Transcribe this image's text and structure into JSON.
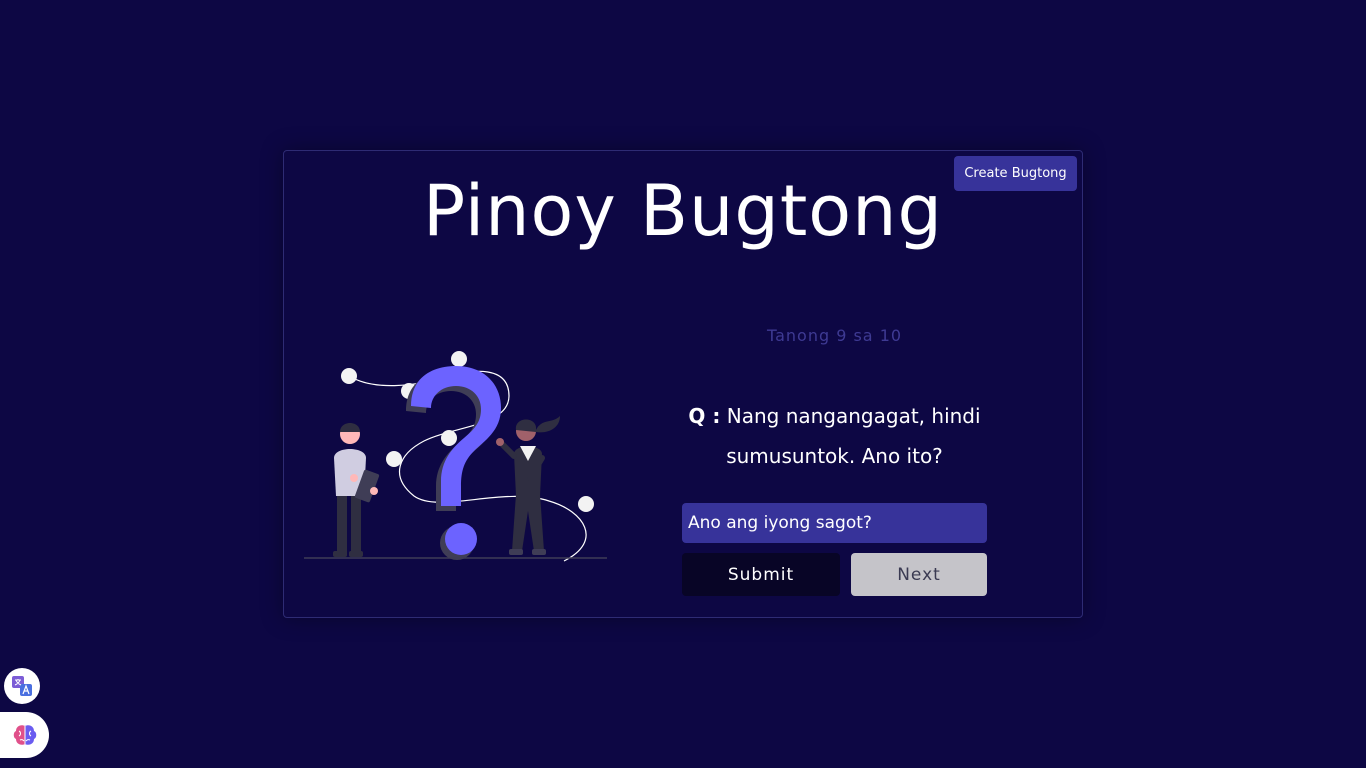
{
  "header": {
    "title": "Pinoy Bugtong",
    "create_label": "Create Bugtong"
  },
  "quiz": {
    "counter": "Tanong 9 sa 10",
    "question_label": "Q :",
    "question_text": "Nang nangangagat, hindi sumusuntok. Ano ito?",
    "answer_placeholder": "Ano ang iyong sagot?",
    "answer_value": "",
    "submit_label": "Submit",
    "next_label": "Next"
  },
  "floating": {
    "translate_icon": "translate-icon",
    "brain_icon": "brain-icon"
  },
  "colors": {
    "background": "#0d0744",
    "accent": "#37339a",
    "question_mark": "#6c63ff",
    "submit_bg": "#080526",
    "next_bg": "#c5c4c9"
  }
}
